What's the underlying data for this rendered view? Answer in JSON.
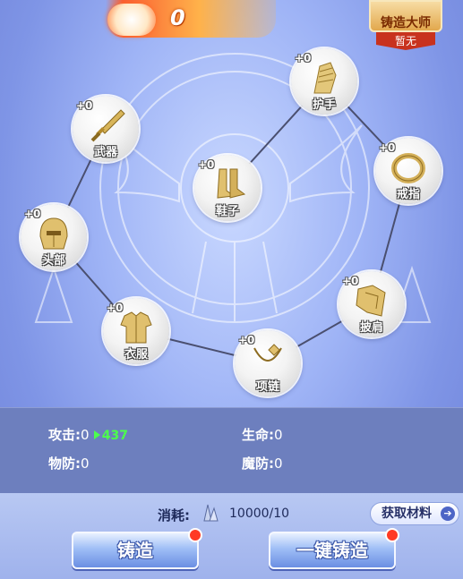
{
  "top_banner": {
    "value": "0",
    "icon": "rabbit-emblem-icon"
  },
  "master_badge": {
    "title": "铸造大师",
    "subtitle": "暂无"
  },
  "equipment": [
    {
      "key": "weapon",
      "name": "武器",
      "level": "+0",
      "icon": "sword-icon"
    },
    {
      "key": "gloves",
      "name": "护手",
      "level": "+0",
      "icon": "gauntlet-icon"
    },
    {
      "key": "shoes",
      "name": "鞋子",
      "level": "+0",
      "icon": "boots-icon"
    },
    {
      "key": "ring",
      "name": "戒指",
      "level": "+0",
      "icon": "ring-icon"
    },
    {
      "key": "helmet",
      "name": "头部",
      "level": "+0",
      "icon": "helmet-icon"
    },
    {
      "key": "cloak",
      "name": "披肩",
      "level": "+0",
      "icon": "shoulder-cape-icon"
    },
    {
      "key": "armor",
      "name": "衣服",
      "level": "+0",
      "icon": "armor-icon"
    },
    {
      "key": "necklace",
      "name": "项链",
      "level": "+0",
      "icon": "necklace-icon"
    }
  ],
  "stats": {
    "attack": {
      "label": "攻击:",
      "value": "0",
      "bonus": "437"
    },
    "hp": {
      "label": "生命:",
      "value": "0"
    },
    "phys_def": {
      "label": "物防:",
      "value": "0"
    },
    "magic_def": {
      "label": "魔防:",
      "value": "0"
    }
  },
  "cost": {
    "label": "消耗:",
    "value": "10000/10",
    "icon": "crystal-material-icon"
  },
  "buttons": {
    "get_material": "获取材料",
    "forge": "铸造",
    "auto_forge": "一键铸造"
  },
  "colors": {
    "bonus_green": "#4cff4c",
    "alert_red": "#ff3a24"
  }
}
